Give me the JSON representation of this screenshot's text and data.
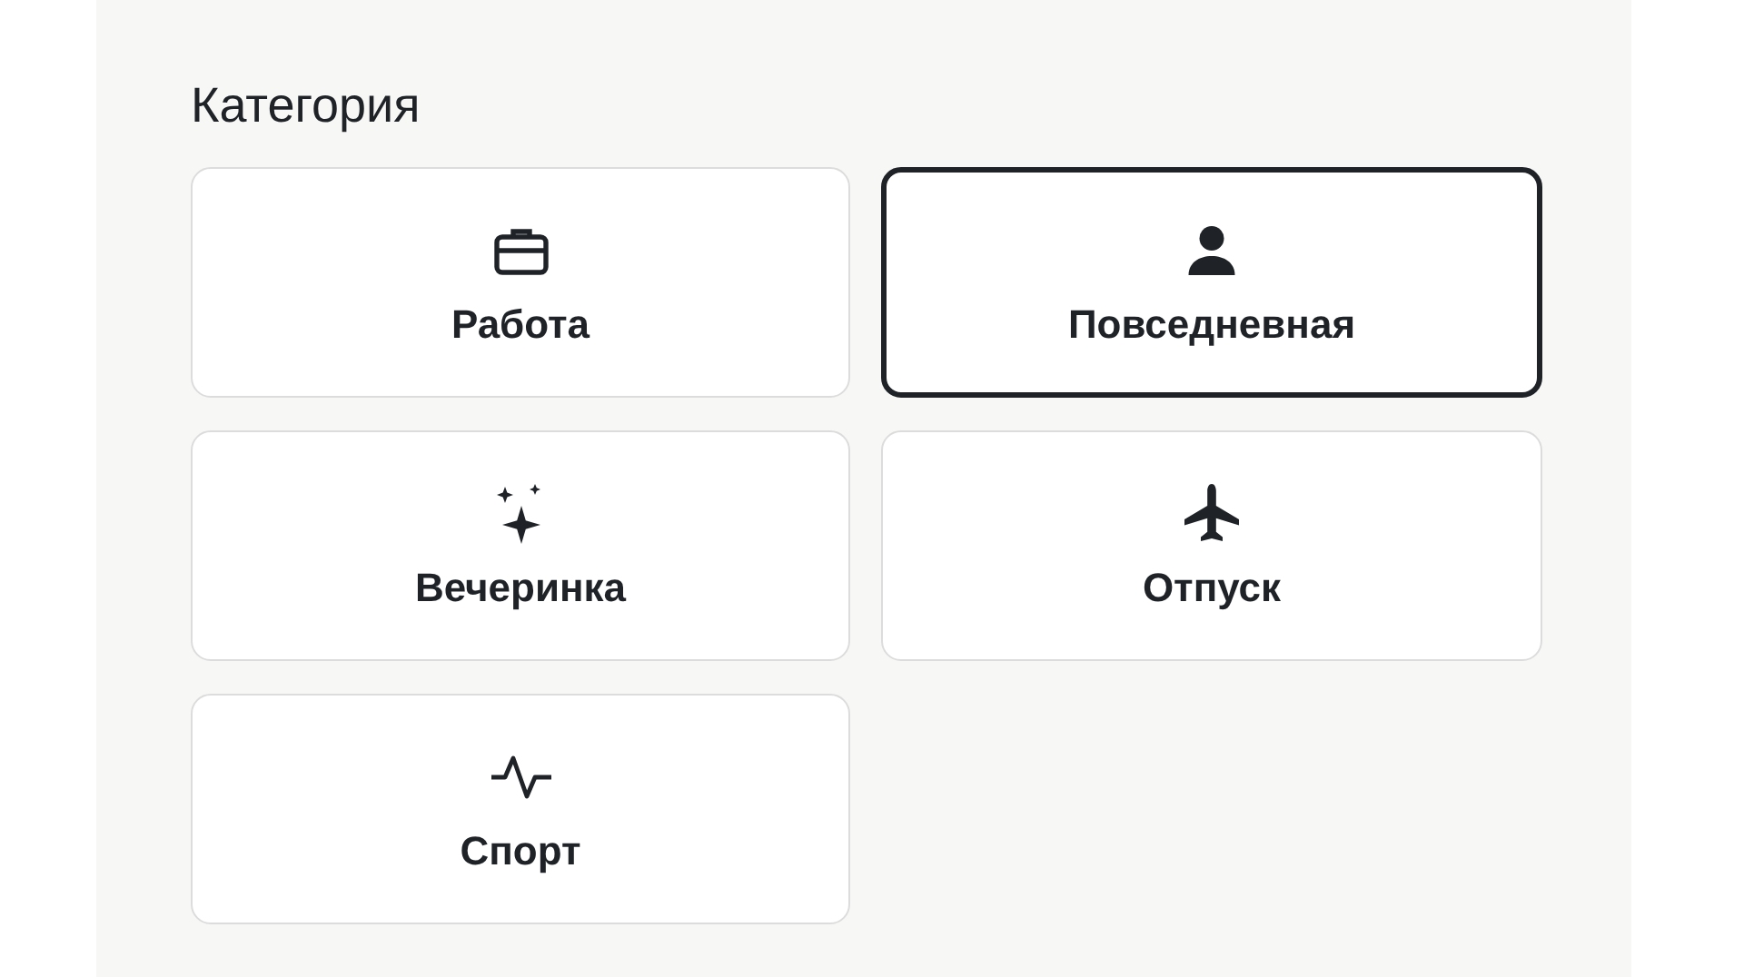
{
  "category": {
    "label": "Категория",
    "options": [
      {
        "label": "Работа",
        "selected": false
      },
      {
        "label": "Повседневная",
        "selected": true
      },
      {
        "label": "Вечеринка",
        "selected": false
      },
      {
        "label": "Отпуск",
        "selected": false
      },
      {
        "label": "Спорт",
        "selected": false
      }
    ]
  }
}
